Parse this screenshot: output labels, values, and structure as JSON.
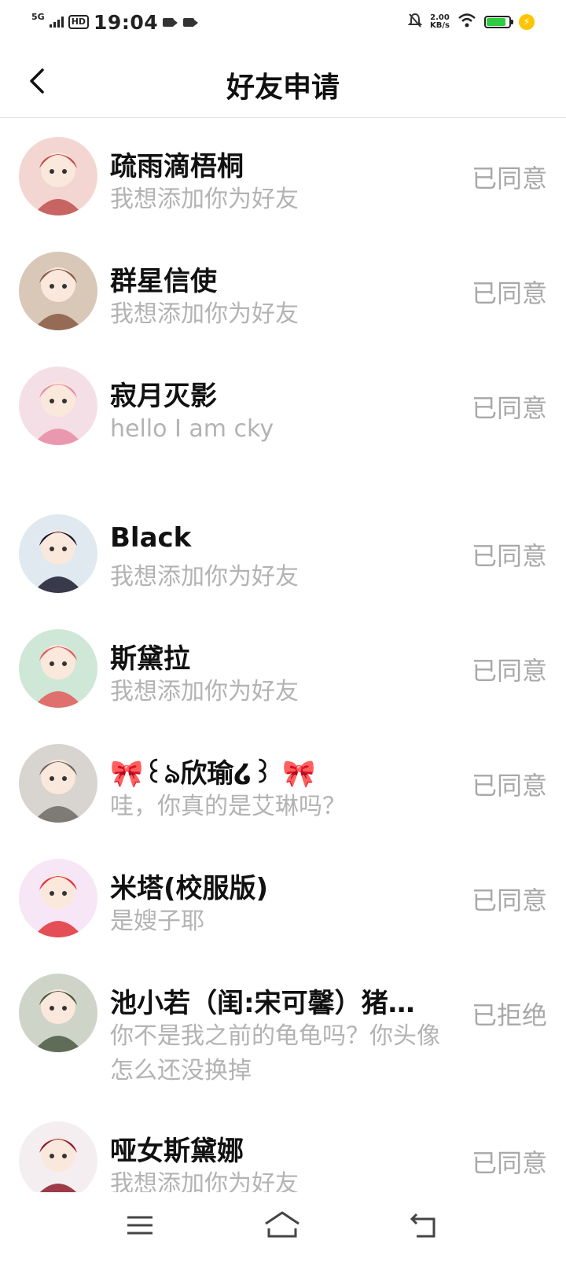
{
  "status_bar": {
    "network": "5G",
    "hd": "HD",
    "time": "19:04",
    "speed_value": "2.00",
    "speed_unit": "KB/s",
    "battery_level": 0.85,
    "icons": [
      "signal-icon",
      "hd-icon",
      "camera-icon",
      "video-icon",
      "mute-icon",
      "wifi-icon",
      "battery-icon",
      "charging-icon"
    ]
  },
  "header": {
    "title": "好友申请",
    "back_icon": "chevron-left-icon"
  },
  "requests": [
    {
      "name": "疏雨滴梧桐",
      "message": "我想添加你为好友",
      "status": "已同意",
      "avatar_colors": [
        "#f3d6d2",
        "#c0504d"
      ]
    },
    {
      "name": "群星信使",
      "message": "我想添加你为好友",
      "status": "已同意",
      "avatar_colors": [
        "#d9c7b8",
        "#8a5a44"
      ]
    },
    {
      "name": "寂月灭影",
      "message": "hello I am cky",
      "status": "已同意",
      "avatar_colors": [
        "#f5dfe6",
        "#e78ca4"
      ]
    },
    {
      "name": "Black",
      "message": "我想添加你为好友",
      "status": "已同意",
      "avatar_colors": [
        "#dfe9ef",
        "#1b1b2e"
      ]
    },
    {
      "name": "斯黛拉",
      "message": "我想添加你为好友",
      "status": "已同意",
      "avatar_colors": [
        "#cfe7d6",
        "#e25a5a"
      ]
    },
    {
      "name": "🎀꒰ঌ欣瑜໒꒱ 🎀",
      "message": "哇，你真的是艾琳吗？",
      "status": "已同意",
      "avatar_colors": [
        "#d8d4d0",
        "#6f6a66"
      ]
    },
    {
      "name": "米塔(校服版)",
      "message": "是嫂子耶",
      "status": "已同意",
      "avatar_colors": [
        "#f6e6f6",
        "#e0323a"
      ]
    },
    {
      "name": "池小若（闺:宋可馨）猪…",
      "message": "你不是我之前的龟龟吗？你头像怎么还没换掉",
      "status": "已拒绝",
      "avatar_colors": [
        "#cfd4c9",
        "#4b5a44"
      ]
    },
    {
      "name": "哑女斯黛娜",
      "message": "我想添加你为好友",
      "status": "已同意",
      "avatar_colors": [
        "#f4eef0",
        "#8c1c2a"
      ]
    }
  ],
  "nav_bar": {
    "icons": [
      "menu-icon",
      "home-icon",
      "back-icon"
    ]
  }
}
